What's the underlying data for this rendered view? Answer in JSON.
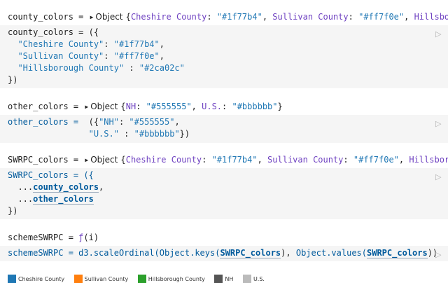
{
  "cell1": {
    "out_name": "county_colors = ",
    "out_obj": "Object {",
    "out_k1": "Cheshire County",
    "out_v1": "\"#1f77b4\"",
    "out_k2": "Sullivan County",
    "out_v2": "\"#ff7f0e\"",
    "out_k3": "Hillsborough Co",
    "src_line1": "county_colors = ({",
    "src_line2_key": "\"Cheshire County\"",
    "src_line2_val": "\"#1f77b4\"",
    "src_line3_key": "\"Sullivan County\"",
    "src_line3_val": "\"#ff7f0e\"",
    "src_line4_key": "\"Hillsborough County\"",
    "src_line4_val": "\"#2ca02c\"",
    "src_line5": "})"
  },
  "cell2": {
    "out_name": "other_colors = ",
    "out_obj": "Object {",
    "out_k1": "NH",
    "out_v1": "\"#555555\"",
    "out_k2": "U.S.",
    "out_v2": "\"#bbbbbb\"",
    "src_line1_a": "other_colors = ",
    "src_line1_key": "\"NH\"",
    "src_line1_val": "\"#555555\"",
    "src_line2_key": "\"U.S.\"",
    "src_line2_val": "\"#bbbbbb\""
  },
  "cell3": {
    "out_name": "SWRPC_colors = ",
    "out_obj": "Object {",
    "out_k1": "Cheshire County",
    "out_v1": "\"#1f77b4\"",
    "out_k2": "Sullivan County",
    "out_v2": "\"#ff7f0e\"",
    "out_k3": "Hillsborough Cou",
    "src_line1": "SWRPC_colors = ({",
    "src_ref1": "county_colors",
    "src_ref2": "other_colors",
    "src_line4": "})"
  },
  "cell4": {
    "out_name": "schemeSWRPC = ",
    "out_fn": "ƒ",
    "out_args": "(i)",
    "src_a": "schemeSWRPC = d3.scaleOrdinal(",
    "src_b": "Object.keys(",
    "src_ref": "SWRPC_colors",
    "src_c": "), ",
    "src_d": "Object.values(",
    "src_e": "))"
  },
  "legend": [
    {
      "label": "Cheshire County",
      "color": "#1f77b4"
    },
    {
      "label": "Sullivan County",
      "color": "#ff7f0e"
    },
    {
      "label": "Hillsborough County",
      "color": "#2ca02c"
    },
    {
      "label": "NH",
      "color": "#555555"
    },
    {
      "label": "U.S.",
      "color": "#bbbbbb"
    }
  ],
  "icons": {
    "run": "play-icon",
    "expand": "triangle-right-icon"
  }
}
